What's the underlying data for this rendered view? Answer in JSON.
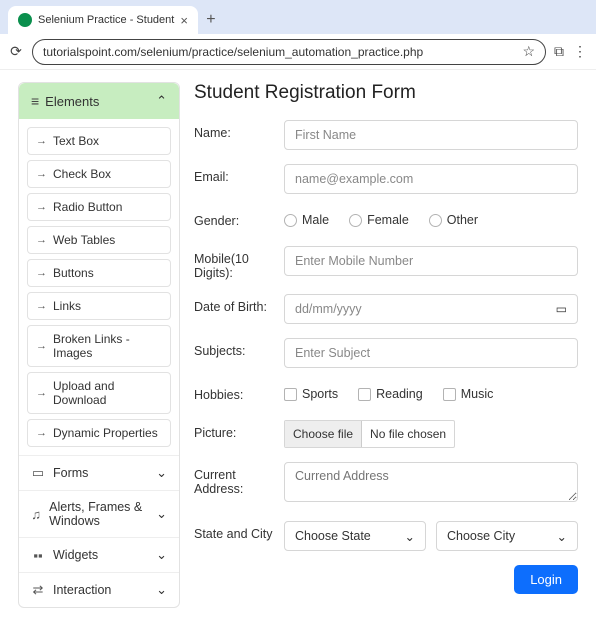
{
  "browser": {
    "tab_title": "Selenium Practice - Student",
    "url": "tutorialspoint.com/selenium/practice/selenium_automation_practice.php"
  },
  "sidebar": {
    "header": "Elements",
    "items": [
      "Text Box",
      "Check Box",
      "Radio Button",
      "Web Tables",
      "Buttons",
      "Links",
      "Broken Links - Images",
      "Upload and Download",
      "Dynamic Properties"
    ],
    "sections": [
      "Forms",
      "Alerts, Frames & Windows",
      "Widgets",
      "Interaction"
    ]
  },
  "form": {
    "title": "Student Registration Form",
    "labels": {
      "name": "Name:",
      "email": "Email:",
      "gender": "Gender:",
      "mobile": "Mobile(10 Digits):",
      "dob": "Date of Birth:",
      "subjects": "Subjects:",
      "hobbies": "Hobbies:",
      "picture": "Picture:",
      "address": "Current Address:",
      "statecity": "State and City"
    },
    "placeholders": {
      "name": "First Name",
      "email": "name@example.com",
      "mobile": "Enter Mobile Number",
      "dob": "dd/mm/yyyy",
      "subjects": "Enter Subject",
      "address": "Currend Address"
    },
    "gender_options": [
      "Male",
      "Female",
      "Other"
    ],
    "hobby_options": [
      "Sports",
      "Reading",
      "Music"
    ],
    "file": {
      "button": "Choose file",
      "status": "No file chosen"
    },
    "state_select": "Choose State",
    "city_select": "Choose City",
    "submit": "Login"
  }
}
